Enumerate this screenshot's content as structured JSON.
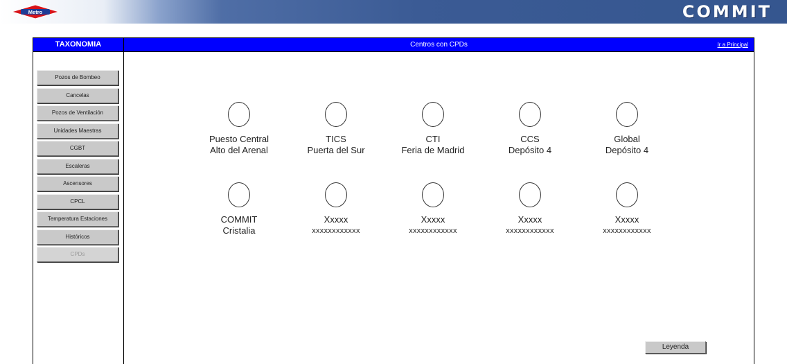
{
  "header": {
    "brand": "COMMIT",
    "logo_text": "Metro"
  },
  "sidebar": {
    "title": "TAXONOMIA",
    "items": [
      {
        "label": "Pozos de Bombeo"
      },
      {
        "label": "Cancelas"
      },
      {
        "label": "Pozos de Ventilación"
      },
      {
        "label": "Unidades Maestras"
      },
      {
        "label": "CGBT"
      },
      {
        "label": "Escaleras"
      },
      {
        "label": "Ascensores"
      },
      {
        "label": "CPCL"
      },
      {
        "label": "Temperatura Estaciones"
      },
      {
        "label": "Históricos"
      },
      {
        "label": "CPDs"
      }
    ]
  },
  "main": {
    "title": "Centros con CPDs",
    "link_principal": "Ir a Principal",
    "centers": [
      {
        "name": "Puesto Central",
        "sub": "Alto del Arenal"
      },
      {
        "name": "TICS",
        "sub": "Puerta del Sur"
      },
      {
        "name": "CTI",
        "sub": "Feria de Madrid"
      },
      {
        "name": "CCS",
        "sub": "Depósito 4"
      },
      {
        "name": "Global",
        "sub": "Depósito 4"
      },
      {
        "name": "COMMIT",
        "sub": "Cristalia"
      },
      {
        "name": "Xxxxx",
        "sub": "xxxxxxxxxxxx"
      },
      {
        "name": "Xxxxx",
        "sub": "xxxxxxxxxxxx"
      },
      {
        "name": "Xxxxx",
        "sub": "xxxxxxxxxxxx"
      },
      {
        "name": "Xxxxx",
        "sub": "xxxxxxxxxxxx"
      }
    ],
    "legend_button": "Leyenda"
  }
}
